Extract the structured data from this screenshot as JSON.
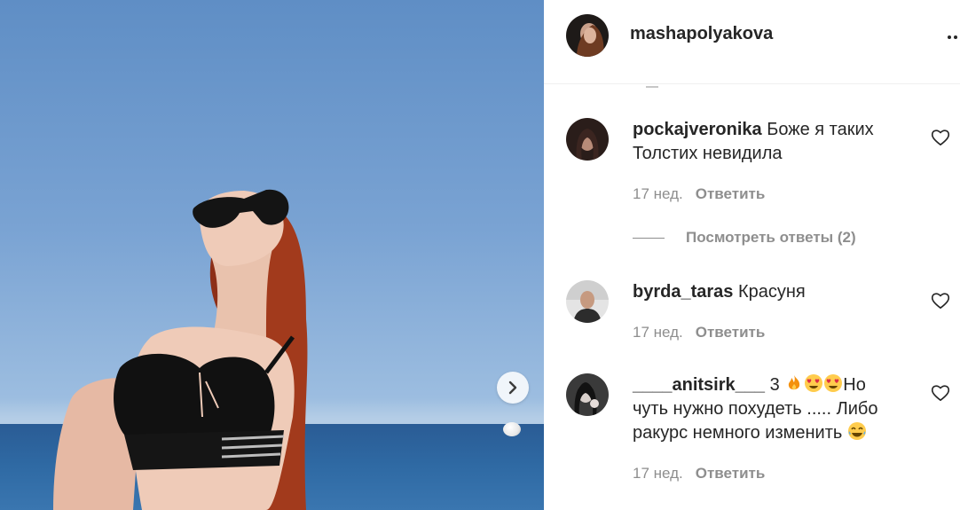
{
  "post": {
    "author": "mashapolyakova"
  },
  "comments": [
    {
      "username": "pockajveronika",
      "text": "Боже я таких Толстих невидила",
      "time": "17 нед.",
      "reply_label": "Ответить",
      "view_replies": "Посмотреть ответы (2)"
    },
    {
      "username": "byrda_taras",
      "text": "Красуня",
      "time": "17 нед.",
      "reply_label": "Ответить"
    },
    {
      "username": "____anitsirk___",
      "text_part1": "3 ",
      "text_part2": "Но чуть нужно похудеть ..... Либо ракурс немного изменить ",
      "time": "17 нед.",
      "reply_label": "Ответить"
    }
  ],
  "icons": {
    "more": "more-options-icon",
    "heart": "heart-outline-icon",
    "next": "chevron-right-icon"
  },
  "colors": {
    "text": "#262626",
    "secondary": "#8e8e8e",
    "divider": "#efefef"
  }
}
